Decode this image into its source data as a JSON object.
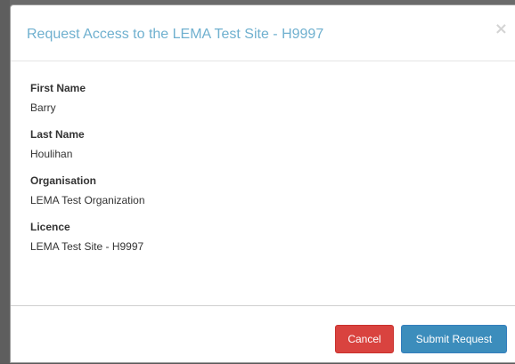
{
  "modal": {
    "title": "Request Access to the LEMA Test Site - H9997",
    "close_glyph": "×"
  },
  "fields": [
    {
      "label": "First Name",
      "value": "Barry"
    },
    {
      "label": "Last Name",
      "value": "Houlihan"
    },
    {
      "label": "Organisation",
      "value": "LEMA Test Organization"
    },
    {
      "label": "Licence",
      "value": "LEMA Test Site - H9997"
    }
  ],
  "footer": {
    "cancel_label": "Cancel",
    "submit_label": "Submit Request"
  },
  "colors": {
    "title": "#6fb0cf",
    "cancel": "#d9433f",
    "submit": "#3c8dbc"
  }
}
